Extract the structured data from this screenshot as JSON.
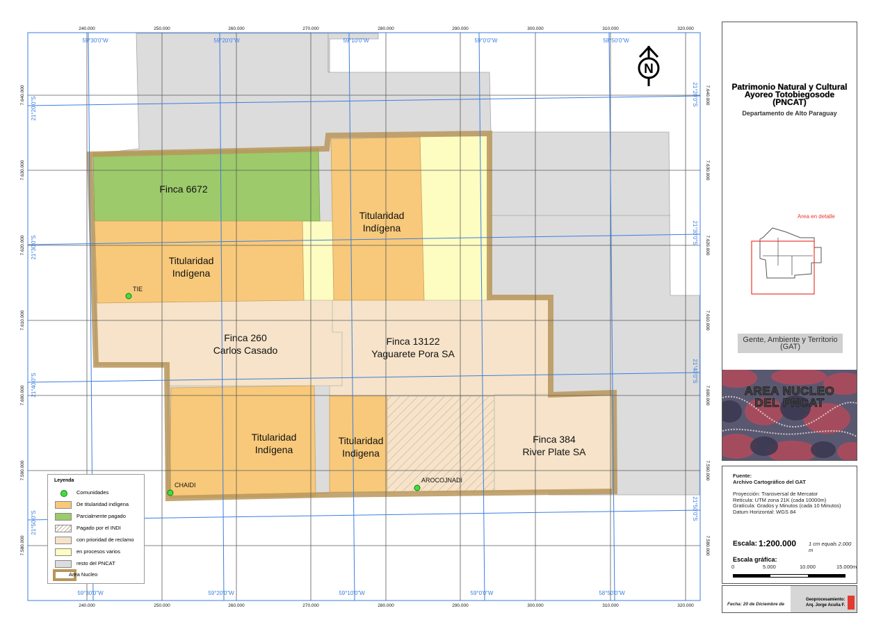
{
  "map": {
    "parcels": [
      {
        "label_lines": [
          "Finca 6672"
        ]
      },
      {
        "label_lines": [
          "Titularidad",
          "Indígena"
        ]
      },
      {
        "label_lines": [
          "Titularidad",
          "Indígena"
        ]
      },
      {
        "label_lines": [
          "Finca 260",
          "Carlos Casado"
        ]
      },
      {
        "label_lines": [
          "Finca 13122",
          "Yaguarete Pora SA"
        ]
      },
      {
        "label_lines": [
          "Titularidad",
          "Indígena"
        ]
      },
      {
        "label_lines": [
          "Titularidad",
          "Indigena"
        ]
      },
      {
        "label_lines": [
          "Finca 384",
          "River Plate SA"
        ]
      }
    ],
    "communities": [
      "TIE",
      "CHAIDI",
      "AROCOJNADI"
    ],
    "easting_ticks": [
      "240.000",
      "250.000",
      "260.000",
      "270.000",
      "280.000",
      "290.000",
      "300.000",
      "310.000",
      "320.000"
    ],
    "northing_ticks": [
      "7.640.000",
      "7.630.000",
      "7.620.000",
      "7.610.000",
      "7.600.000",
      "7.590.000",
      "7.580.000"
    ],
    "lon_ticks": [
      "59°30'0\"W",
      "59°20'0\"W",
      "59°10'0\"W",
      "59°0'0\"W",
      "58°50'0\"W"
    ],
    "lat_ticks": [
      "21°20'0\"S",
      "21°30'0\"S",
      "21°40'0\"S",
      "21°50'0\"S"
    ],
    "north_letter": "N",
    "colors": {
      "titularidad": "#f8c97a",
      "parcialmente": "#9dca6b",
      "reclamo": "#f6e3c9",
      "procesos": "#fdfcc1",
      "resto": "#dcdcdc",
      "nucleo_border": "#b8965a",
      "grid_blue": "#3a7ee0"
    }
  },
  "legend": {
    "title": "Leyenda",
    "items": [
      "Comunidades",
      "De titularidad indígena",
      "Parcialmente pagado",
      "Pagado por el INDI",
      "con prioridad de reclamo",
      "en procesos varios",
      "resto del PNCAT",
      "Area Nucleo"
    ]
  },
  "title_panel": {
    "title_lines": [
      "Patrimonio Natural y Cultural",
      "Ayoreo Totobiegosode",
      "(PNCAT)"
    ],
    "subtitle": "Departamento de Alto Paraguay",
    "inset_label": "Area en detalle",
    "org_lines": [
      "Gente, Ambiente y Territorio",
      "(GAT)"
    ],
    "photo_title_lines": [
      "AREA NUCLEO",
      "DEL PNCAT"
    ]
  },
  "info_panel": {
    "source_label": "Fuente:",
    "source_value": "Archivo Cartográfico del GAT",
    "projection_lines": [
      "Proyección: Transversal de Mercator",
      "Retícula: UTM zona 21K (cada 10000m)",
      "Gratícula: Grados y Minutos (cada 10 Minutos)",
      "Datum Horizontal: WGS 84"
    ],
    "scale_label": "Escala:",
    "scale_value": "1:200.000",
    "scale_note": "1 cm equals 2.000 m",
    "graphic_scale_label": "Escala gráfica:",
    "scale_ticks": [
      "0",
      "5.000",
      "10.000",
      "15.000m"
    ]
  },
  "footer": {
    "date": "Fecha: 20 de Diciembre de",
    "geoproc_label": "Geoprocesamiento:",
    "author": "Arq. Jorge Acuña F."
  }
}
